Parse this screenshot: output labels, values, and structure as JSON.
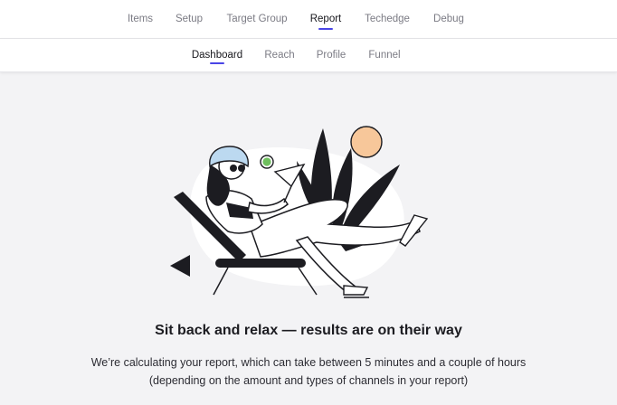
{
  "top_nav": {
    "tabs": [
      {
        "label": "Items"
      },
      {
        "label": "Setup"
      },
      {
        "label": "Target Group"
      },
      {
        "label": "Report"
      },
      {
        "label": "Techedge"
      },
      {
        "label": "Debug"
      }
    ],
    "active": "Report"
  },
  "sub_nav": {
    "tabs": [
      {
        "label": "Dashboard"
      },
      {
        "label": "Reach"
      },
      {
        "label": "Profile"
      },
      {
        "label": "Funnel"
      }
    ],
    "active": "Dashboard"
  },
  "main": {
    "headline": "Sit back and relax — results are on their way",
    "description": "We’re calculating your report, which can take between 5 minutes and a couple of hours (depending on the amount and types of channels in your report)"
  },
  "colors": {
    "accent": "#4a45e6",
    "sun": "#f7c79a",
    "cap": "#bcd9f0",
    "lime": "#6fbf5e"
  }
}
